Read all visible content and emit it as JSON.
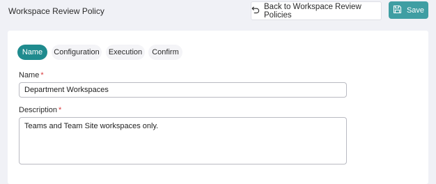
{
  "header": {
    "title": "Workspace Review Policy",
    "back_label": "Back to Workspace Review Policies",
    "save_label": "Save"
  },
  "tabs": [
    {
      "label": "Name",
      "active": true
    },
    {
      "label": "Configuration",
      "active": false
    },
    {
      "label": "Execution",
      "active": false
    },
    {
      "label": "Confirm",
      "active": false
    }
  ],
  "form": {
    "name_label": "Name",
    "name_value": "Department Workspaces",
    "description_label": "Description",
    "description_value": "Teams and Team Site workspaces only.",
    "required_marker": "*"
  },
  "colors": {
    "accent": "#1f8b8e",
    "save_button": "#3f9ea3",
    "required": "#d8383b",
    "background": "#f0f1f6"
  }
}
